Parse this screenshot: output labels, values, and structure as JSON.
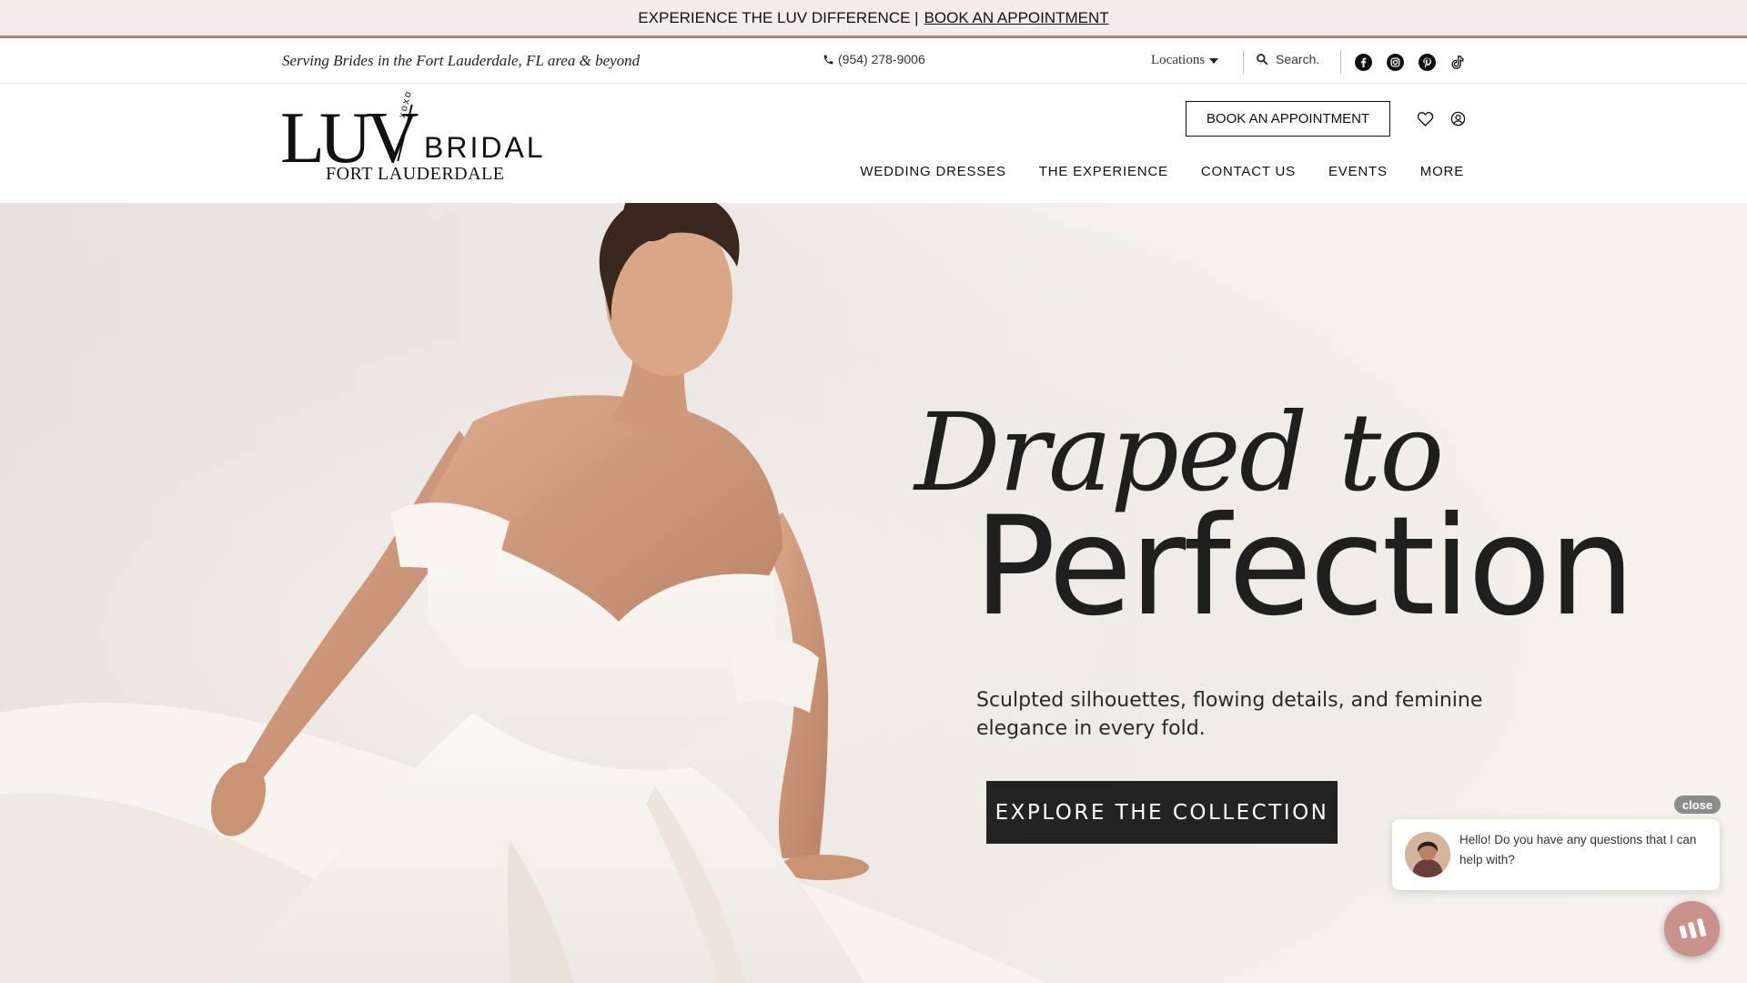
{
  "announcement": {
    "text": "EXPERIENCE THE LUV DIFFERENCE |",
    "link": "BOOK AN APPOINTMENT"
  },
  "utility": {
    "serving": "Serving Brides in the Fort Lauderdale, FL area & beyond",
    "phone": "(954) 278-9006",
    "locations": "Locations",
    "search_placeholder": "Search.",
    "social": [
      "facebook-icon",
      "instagram-icon",
      "pinterest-icon",
      "tiktok-icon"
    ]
  },
  "header": {
    "logo_main": "LUV",
    "logo_xo": "xoxo",
    "logo_bridal": "BRIDAL",
    "logo_sub": "FORT LAUDERDALE",
    "book_label": "BOOK AN APPOINTMENT",
    "nav": [
      "WEDDING DRESSES",
      "THE EXPERIENCE",
      "CONTACT US",
      "EVENTS",
      "MORE"
    ]
  },
  "hero": {
    "title_line1": "Draped to",
    "title_line2": "Perfection",
    "tagline": "Sculpted silhouettes, flowing details, and feminine elegance in every fold.",
    "cta": "EXPLORE THE COLLECTION"
  },
  "chat": {
    "close_label": "close",
    "message": "Hello! Do you have any questions that I can help with?"
  },
  "colors": {
    "announcement_bg": "#f3eded",
    "announcement_border": "#a88670",
    "cta_bg": "#232323",
    "chat_launcher": "#c9928a"
  }
}
